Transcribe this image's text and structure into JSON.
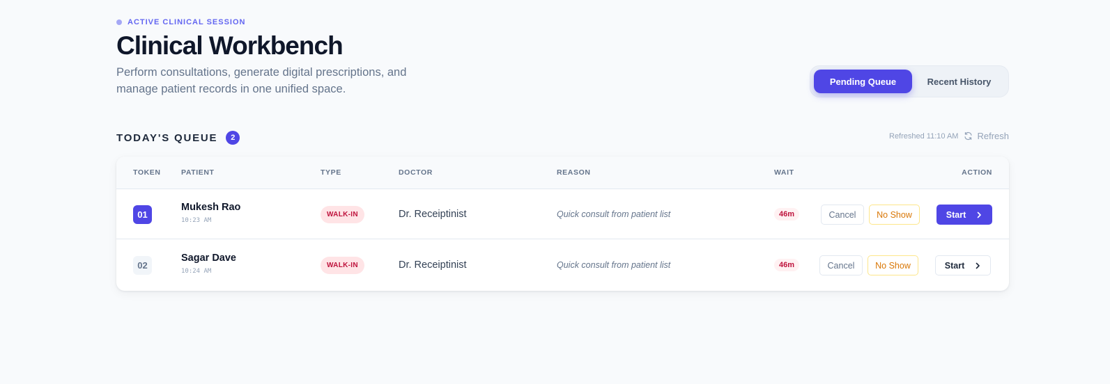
{
  "header": {
    "session_label": "ACTIVE CLINICAL SESSION",
    "title": "Clinical Workbench",
    "subtitle": "Perform consultations, generate digital prescriptions, and manage patient records in one unified space."
  },
  "tabs": {
    "active": "Pending Queue",
    "inactive": "Recent History"
  },
  "queue": {
    "title": "TODAY'S QUEUE",
    "count": "2",
    "refreshed_text": "Refreshed 11:10 AM",
    "refresh_label": "Refresh",
    "columns": {
      "token": "TOKEN",
      "patient": "PATIENT",
      "type": "TYPE",
      "doctor": "DOCTOR",
      "reason": "REASON",
      "wait": "WAIT",
      "action": "ACTION"
    },
    "rows": [
      {
        "token": "01",
        "patient": "Mukesh Rao",
        "time": "10:23 AM",
        "type": "WALK-IN",
        "doctor": "Dr. Receiptinist",
        "reason": "Quick consult from patient list",
        "wait": "46m",
        "cancel": "Cancel",
        "no_show": "No Show",
        "start": "Start"
      },
      {
        "token": "02",
        "patient": "Sagar Dave",
        "time": "10:24 AM",
        "type": "WALK-IN",
        "doctor": "Dr. Receiptinist",
        "reason": "Quick consult from patient list",
        "wait": "46m",
        "cancel": "Cancel",
        "no_show": "No Show",
        "start": "Start"
      }
    ]
  },
  "colors": {
    "accent": "#4f46e5",
    "walk_in_bg": "#ffe4e6",
    "walk_in_text": "#be123c",
    "no_show": "#d97706"
  },
  "icons": {
    "status_dot": "dot-icon",
    "refresh": "refresh-icon",
    "start_arrow": "chevron-right-icon"
  }
}
